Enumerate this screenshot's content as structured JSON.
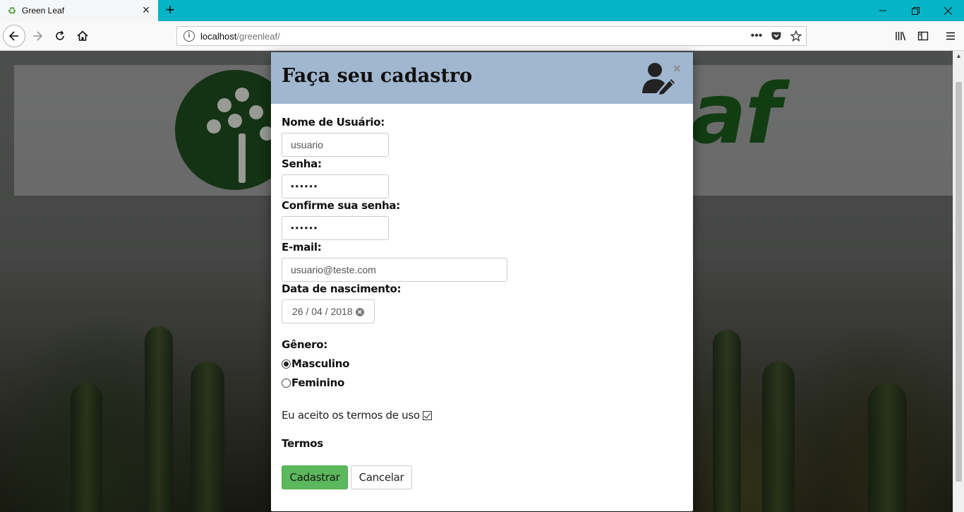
{
  "browser": {
    "tab_title": "Green Leaf",
    "url_host": "localhost",
    "url_path": "/greenleaf/"
  },
  "page": {
    "logo_text": "af"
  },
  "modal": {
    "title": "Faça seu cadastro",
    "close_label": "×",
    "fields": {
      "username_label": "Nome de Usuário:",
      "username_value": "usuario",
      "password_label": "Senha:",
      "password_value": "••••••",
      "confirm_label": "Confirme sua senha:",
      "confirm_value": "••••••",
      "email_label": "E-mail:",
      "email_value": "usuario@teste.com",
      "birthdate_label": "Data de nascimento:",
      "birthdate_value": "26 / 04 / 2018"
    },
    "gender": {
      "label": "Gênero:",
      "options": [
        "Masculino",
        "Feminino"
      ],
      "selected": "Masculino"
    },
    "terms_accept_label": "Eu aceito os termos de uso",
    "terms_accepted": true,
    "terms_link": "Termos",
    "submit_label": "Cadastrar",
    "cancel_label": "Cancelar"
  },
  "colors": {
    "header_bg": "#a1b7cf",
    "submit_bg": "#5cb85c",
    "tabbar_bg": "#05b4c6",
    "logo_green": "#1d5d1b"
  }
}
